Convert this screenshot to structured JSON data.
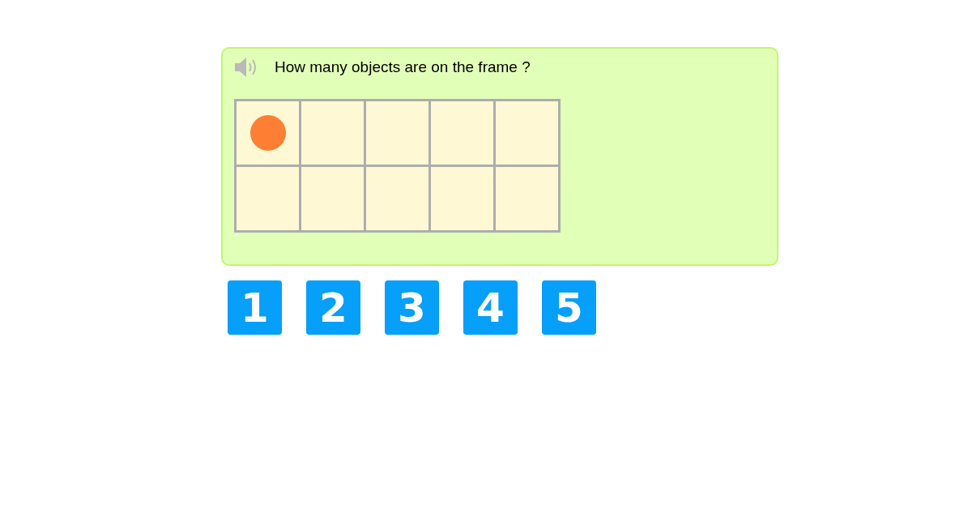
{
  "question": {
    "text": "How many objects are on the frame ?"
  },
  "frame": {
    "cells": [
      {
        "filled": true
      },
      {
        "filled": false
      },
      {
        "filled": false
      },
      {
        "filled": false
      },
      {
        "filled": false
      },
      {
        "filled": false
      },
      {
        "filled": false
      },
      {
        "filled": false
      },
      {
        "filled": false
      },
      {
        "filled": false
      }
    ]
  },
  "answers": [
    "1",
    "2",
    "3",
    "4",
    "5"
  ]
}
